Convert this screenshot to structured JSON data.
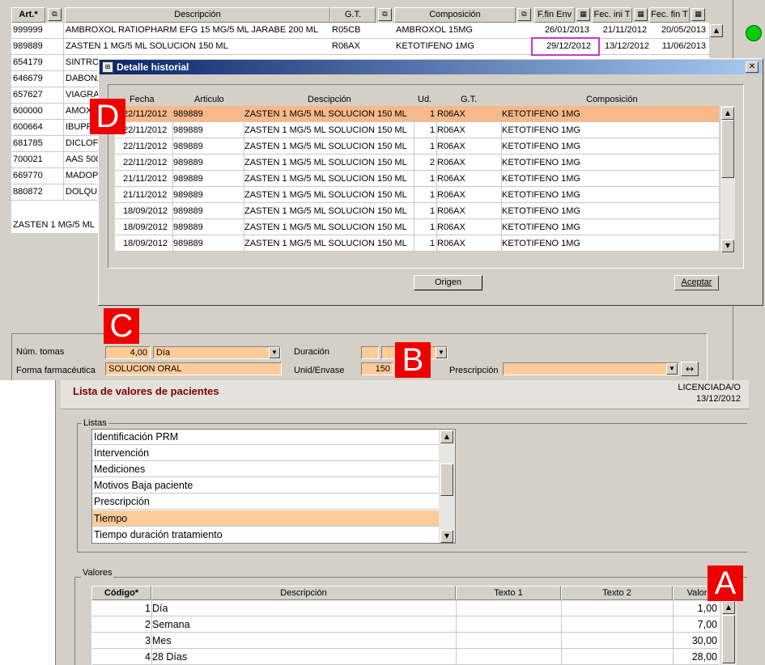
{
  "articles_table": {
    "headers": {
      "art": "Art.*",
      "descripcion": "Descripción",
      "gt": "G.T.",
      "composicion": "Composición",
      "ffin_env": "F.fin Env",
      "fec_ini": "Fec. ini T",
      "fec_fin": "Fec. fin T"
    },
    "rows": [
      {
        "art": "999999",
        "desc": "AMBROXOL RATIOPHARM EFG 15 MG/5 ML JARABE 200 ML",
        "gt": "R05CB",
        "comp": "AMBROXOL 15MG",
        "ffin": "26/01/2013",
        "fini": "21/11/2012",
        "ffint": "20/05/2013"
      },
      {
        "art": "989889",
        "desc": "ZASTEN 1 MG/5 ML SOLUCION 150 ML",
        "gt": "R06AX",
        "comp": "KETOTIFENO 1MG",
        "ffin": "29/12/2012",
        "fini": "13/12/2012",
        "ffint": "11/06/2013"
      },
      {
        "art": "654179",
        "desc": "SINTRO"
      },
      {
        "art": "646679",
        "desc": "DABONA"
      },
      {
        "art": "657627",
        "desc": "VIAGRA"
      },
      {
        "art": "600000",
        "desc": "AMOX"
      },
      {
        "art": "600664",
        "desc": "IBUPR"
      },
      {
        "art": "681785",
        "desc": "DICLOF"
      },
      {
        "art": "700021",
        "desc": "AAS 500"
      },
      {
        "art": "669770",
        "desc": "MADOP"
      },
      {
        "art": "880872",
        "desc": "DOLQUI"
      }
    ],
    "footer_text": "ZASTEN 1 MG/5 ML"
  },
  "detalle_historial": {
    "title": "Detalle historial",
    "headers": {
      "fecha": "Fecha",
      "articulo": "Articulo",
      "descripcion": "Descipción",
      "ud": "Ud.",
      "gt": "G.T.",
      "composicion": "Composición"
    },
    "rows": [
      {
        "fecha": "22/11/2012",
        "art": "989889",
        "desc": "ZASTEN 1 MG/5 ML SOLUCION 150 ML",
        "ud": "1",
        "gt": "R06AX",
        "comp": "KETOTIFENO 1MG"
      },
      {
        "fecha": "22/11/2012",
        "art": "989889",
        "desc": "ZASTEN 1 MG/5 ML SOLUCION 150 ML",
        "ud": "1",
        "gt": "R06AX",
        "comp": "KETOTIFENO 1MG"
      },
      {
        "fecha": "22/11/2012",
        "art": "989889",
        "desc": "ZASTEN 1 MG/5 ML SOLUCION 150 ML",
        "ud": "1",
        "gt": "R06AX",
        "comp": "KETOTIFENO 1MG"
      },
      {
        "fecha": "22/11/2012",
        "art": "989889",
        "desc": "ZASTEN 1 MG/5 ML SOLUCION 150 ML",
        "ud": "2",
        "gt": "R06AX",
        "comp": "KETOTIFENO 1MG"
      },
      {
        "fecha": "21/11/2012",
        "art": "989889",
        "desc": "ZASTEN 1 MG/5 ML SOLUCION 150 ML",
        "ud": "1",
        "gt": "R06AX",
        "comp": "KETOTIFENO 1MG"
      },
      {
        "fecha": "21/11/2012",
        "art": "989889",
        "desc": "ZASTEN 1 MG/5 ML SOLUCION 150 ML",
        "ud": "1",
        "gt": "R06AX",
        "comp": "KETOTIFENO 1MG"
      },
      {
        "fecha": "18/09/2012",
        "art": "989889",
        "desc": "ZASTEN 1 MG/5 ML SOLUCION 150 ML",
        "ud": "1",
        "gt": "R06AX",
        "comp": "KETOTIFENO 1MG"
      },
      {
        "fecha": "18/09/2012",
        "art": "989889",
        "desc": "ZASTEN 1 MG/5 ML SOLUCION 150 ML",
        "ud": "1",
        "gt": "R06AX",
        "comp": "KETOTIFENO 1MG"
      },
      {
        "fecha": "18/09/2012",
        "art": "989889",
        "desc": "ZASTEN 1 MG/5 ML SOLUCION 150 ML",
        "ud": "1",
        "gt": "R06AX",
        "comp": "KETOTIFENO 1MG"
      }
    ],
    "buttons": {
      "origen": "Origen",
      "aceptar": "Aceptar"
    }
  },
  "form": {
    "num_tomas_label": "Núm. tomas",
    "num_tomas_value": "4,00",
    "num_tomas_unit": "Día",
    "duracion_label": "Duración",
    "forma_label": "Forma farmacéutica",
    "forma_value": "SOLUCION ORAL",
    "unid_envase_label": "Unid/Envase",
    "unid_envase_value": "150",
    "prescripcion_label": "Prescripción",
    "swap_icon": "↔"
  },
  "lista_valores": {
    "title": "Lista de valores de pacientes",
    "user": "LICENCIADA/O",
    "date": "13/12/2012",
    "listas_label": "Listas",
    "listas": [
      "Identificación PRM",
      "Intervención",
      "Mediciones",
      "Motivos Baja paciente",
      "Prescripción",
      "Tiempo",
      "Tiempo duración tratamiento"
    ],
    "valores_label": "Valores",
    "valores_headers": {
      "codigo": "Código*",
      "descripcion": "Descripción",
      "texto1": "Texto 1",
      "texto2": "Texto 2",
      "valor": "Valor"
    },
    "valores": [
      {
        "codigo": "1",
        "desc": "Día",
        "valor": "1,00"
      },
      {
        "codigo": "2",
        "desc": "Semana",
        "valor": "7,00"
      },
      {
        "codigo": "3",
        "desc": "Mes",
        "valor": "30,00"
      },
      {
        "codigo": "4",
        "desc": "28 Días",
        "valor": "28,00"
      }
    ]
  },
  "annotations": {
    "a": "A",
    "b": "B",
    "c": "C",
    "d": "D"
  },
  "colors": {
    "highlight": "#ffcc99",
    "selected_row": "#f8b888",
    "marker": "#e00000",
    "title_dark": "#0a246a",
    "title_light": "#a6caf0"
  }
}
